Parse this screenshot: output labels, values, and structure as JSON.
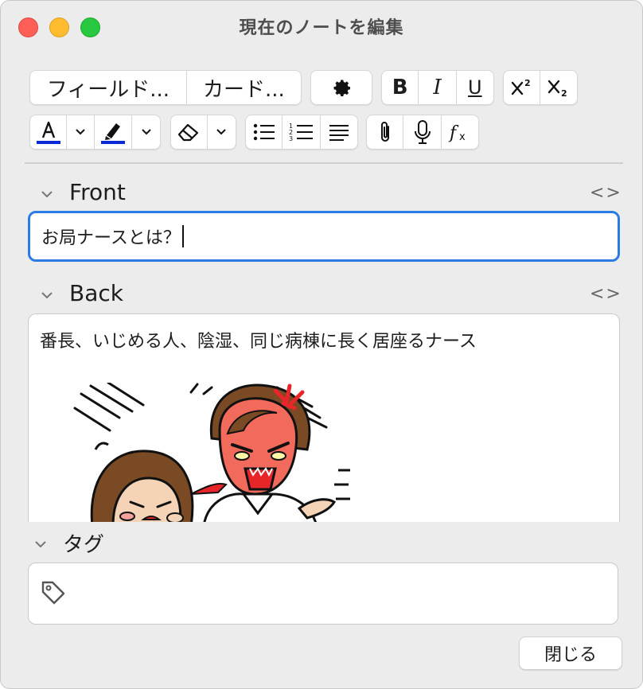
{
  "window": {
    "title": "現在のノートを編集"
  },
  "toolbar": {
    "fields_label": "フィールド...",
    "cards_label": "カード...",
    "bold_label": "B",
    "italic_label": "I",
    "underline_label": "U",
    "text_color": "#0a2ad6",
    "highlight_color": "#0a2ad6"
  },
  "editor": {
    "front": {
      "label": "Front",
      "value": "お局ナースとは？"
    },
    "back": {
      "label": "Back",
      "value": "番長、いじめる人、陰湿、同じ病棟に長く居座るナース"
    },
    "tags": {
      "label": "タグ"
    }
  },
  "footer": {
    "close_label": "閉じる"
  },
  "colors": {
    "focus_ring": "#2a7be4",
    "accent_red": "#e8262a"
  }
}
